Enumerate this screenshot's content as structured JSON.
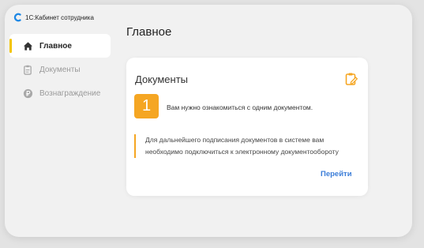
{
  "app": {
    "name": "1С:Кабинет сотрудника",
    "logo_color": "#1e88e5"
  },
  "sidebar": {
    "items": [
      {
        "label": "Главное",
        "icon": "home-icon",
        "active": true
      },
      {
        "label": "Документы",
        "icon": "document-icon",
        "active": false
      },
      {
        "label": "Вознаграждение",
        "icon": "ruble-coin-icon",
        "active": false
      }
    ]
  },
  "main": {
    "title": "Главное",
    "card": {
      "title": "Документы",
      "edit_icon": "clipboard-edit-icon",
      "count": "1",
      "count_text": "Вам нужно ознакомиться с одним документом.",
      "notice_line1": "Для дальнейшего подписания документов в системе вам",
      "notice_line2": "необходимо подключиться к электронному документообороту",
      "action_label": "Перейти"
    }
  },
  "colors": {
    "accent": "#f5a623",
    "active_marker": "#f3c400",
    "link": "#3b7dd8"
  }
}
